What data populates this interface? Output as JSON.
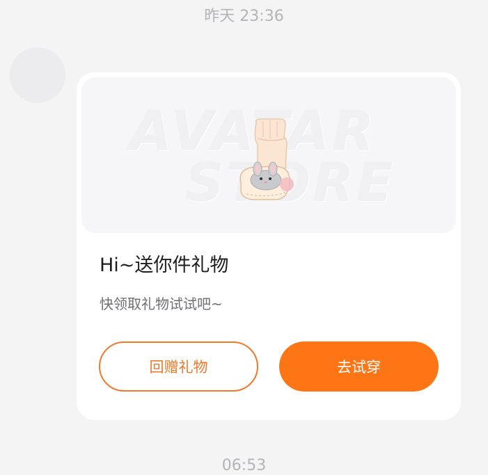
{
  "timestamps": {
    "top": "昨天 23:36",
    "bottom": "06:53"
  },
  "card": {
    "banner": {
      "watermark_line1": "AVATAR",
      "watermark_line2": "STORE",
      "item_icon": "sock-icon"
    },
    "title": "Hi~送你件礼物",
    "subtitle": "快领取礼物试试吧~",
    "buttons": {
      "return_gift": "回赠礼物",
      "try_on": "去试穿"
    }
  },
  "colors": {
    "accent": "#fd7514",
    "outline": "#f0782a",
    "background": "#f4f4f5"
  }
}
